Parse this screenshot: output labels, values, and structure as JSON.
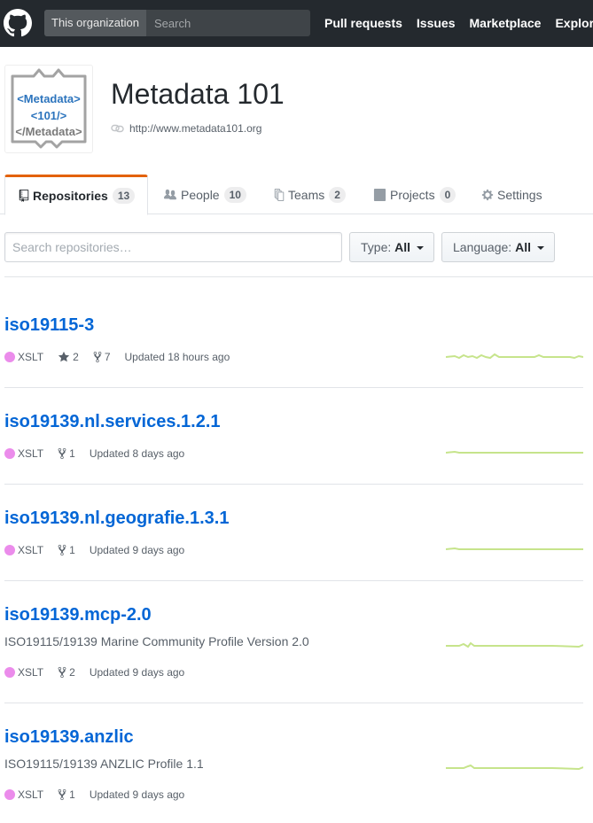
{
  "header": {
    "scope_label": "This organization",
    "search_placeholder": "Search",
    "nav": [
      "Pull requests",
      "Issues",
      "Marketplace",
      "Explore"
    ]
  },
  "org": {
    "name": "Metadata 101",
    "url": "http://www.metadata101.org",
    "avatar_lines": [
      "<Metadata>",
      "<101/>",
      "</Metadata>"
    ]
  },
  "tabs": [
    {
      "label": "Repositories",
      "count": "13",
      "icon": "repo-icon"
    },
    {
      "label": "People",
      "count": "10",
      "icon": "people-icon"
    },
    {
      "label": "Teams",
      "count": "2",
      "icon": "teams-icon"
    },
    {
      "label": "Projects",
      "count": "0",
      "icon": "project-icon"
    },
    {
      "label": "Settings",
      "icon": "gear-icon"
    }
  ],
  "filters": {
    "search_placeholder": "Search repositories…",
    "type_label": "Type:",
    "type_value": "All",
    "language_label": "Language:",
    "language_value": "All"
  },
  "repos": [
    {
      "name": "iso19115-3",
      "description": "",
      "language": "XSLT",
      "stars": "2",
      "forks": "7",
      "updated": "Updated 18 hours ago"
    },
    {
      "name": "iso19139.nl.services.1.2.1",
      "description": "",
      "language": "XSLT",
      "forks": "1",
      "updated": "Updated 8 days ago"
    },
    {
      "name": "iso19139.nl.geografie.1.3.1",
      "description": "",
      "language": "XSLT",
      "forks": "1",
      "updated": "Updated 9 days ago"
    },
    {
      "name": "iso19139.mcp-2.0",
      "description": "ISO19115/19139 Marine Community Profile Version 2.0",
      "language": "XSLT",
      "forks": "2",
      "updated": "Updated 9 days ago"
    },
    {
      "name": "iso19139.anzlic",
      "description": "ISO19115/19139 ANZLIC Profile 1.1",
      "language": "XSLT",
      "forks": "1",
      "updated": "Updated 9 days ago"
    }
  ],
  "colors": {
    "accent_tab": "#e36209",
    "link": "#0366d6",
    "xslt": "#EB8CEB",
    "spark": "#c6e48b"
  }
}
